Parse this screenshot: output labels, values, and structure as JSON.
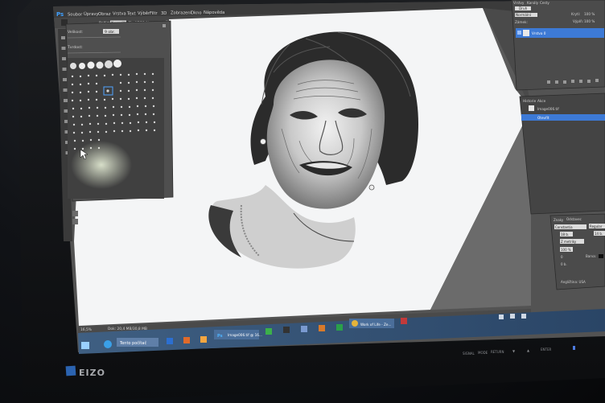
{
  "menu": {
    "ps_logo": "Ps",
    "items": [
      "Soubor",
      "Úpravy",
      "Obraz",
      "Vrstva",
      "Text",
      "Výběr",
      "Filtr",
      "3D",
      "Zobrazení",
      "Okno",
      "Nápověda"
    ]
  },
  "options_bar": {
    "mode_label": "Režim:",
    "mode_value": "Normální",
    "opacity_label": "Krytí:",
    "opacity_value": "100 %",
    "flow_label": "Tok:",
    "flow_value": "100 %",
    "history_label": "Malovat z historie"
  },
  "brush_panel": {
    "size_label": "Velikost:",
    "size_value": "9 obr.",
    "hardness_label": "Tvrdost:"
  },
  "layers_panel": {
    "tabs": [
      "Vrstvy",
      "Kanály",
      "Cesty"
    ],
    "kind_label": "Druh",
    "blend_value": "Normální",
    "opacity_label": "Krytí:",
    "opacity_value": "100 %",
    "lock_label": "Zámek:",
    "fill_label": "Výplň:",
    "fill_value": "100 %",
    "layer_name": "Vrstva 0"
  },
  "history_panel": {
    "tabs": [
      "Historie",
      "Akce"
    ],
    "snapshot": "Image006.tif",
    "step": "Otevřít"
  },
  "character_panel": {
    "tabs": [
      "Znaky",
      "Odstavec"
    ],
    "font_family": "Constantia",
    "font_style": "Regular",
    "size_value": "18 b.",
    "leading_value": "14 b.",
    "tracking_label": "Z metriky",
    "scale_value": "100 %",
    "kern_value": "0",
    "baseline_value": "0 b.",
    "color_label": "Barva:",
    "lang_value": "Angličtina: USA"
  },
  "status_bar": {
    "zoom": "16,5%",
    "doc": "Dok: 20,4 MB/30,8 MB"
  },
  "taskbar": {
    "task1": "Tento počítač",
    "task2": "Image006.tif @ 16...",
    "task3": "Work of Life - Ze..."
  },
  "monitor_brand": "EIZO",
  "monitor_buttons": [
    "SIGNAL",
    "MODE",
    "RETURN",
    "▼",
    "▲",
    "ENTER"
  ]
}
